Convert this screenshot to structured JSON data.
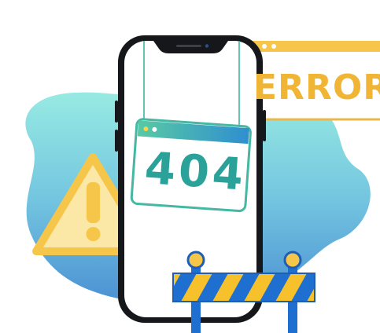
{
  "illustration": {
    "error_sign_text": "ERROR",
    "hanging_sign_text": "404",
    "icons": [
      "warning-triangle-icon",
      "smartphone-icon",
      "barricade-icon",
      "browser-window-icon"
    ]
  },
  "colors": {
    "blob_top": "#8fe6df",
    "blob_bottom": "#4f97d6",
    "accent_yellow": "#f6c64a",
    "error_text": "#f1b536",
    "teal_text": "#2aa29a",
    "phone_frame": "#16181c",
    "barricade_blue": "#1e6fd0",
    "barricade_yellow": "#f7c12c"
  }
}
